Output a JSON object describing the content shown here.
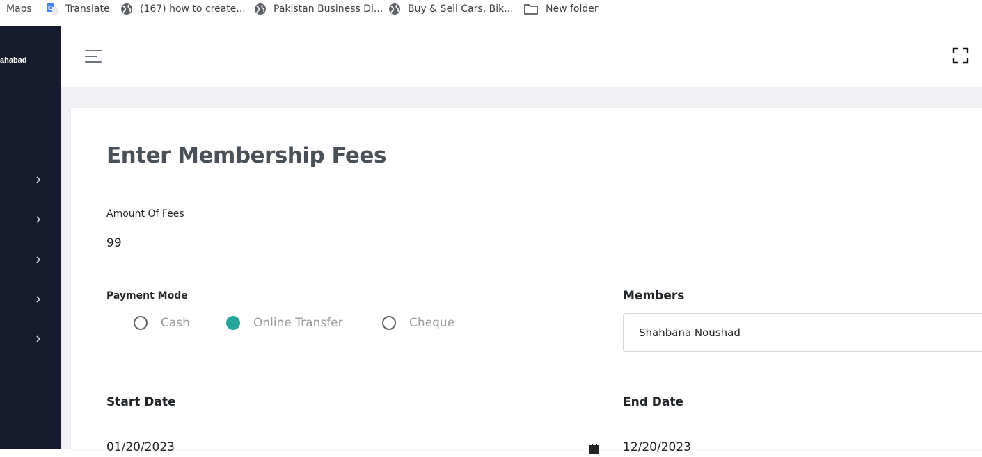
{
  "bookmarks": [
    {
      "label": "Maps",
      "icon": "maps-icon"
    },
    {
      "label": "Translate",
      "icon": "google-translate-icon"
    },
    {
      "label": "(167) how to create...",
      "icon": "globe-icon"
    },
    {
      "label": "Pakistan Business Di...",
      "icon": "globe-icon"
    },
    {
      "label": "Buy & Sell Cars, Bik...",
      "icon": "globe-icon"
    },
    {
      "label": "New folder",
      "icon": "folder-icon"
    }
  ],
  "sidebar": {
    "brand": "ahabad",
    "bg_color": "#161b2e"
  },
  "topbar": {
    "menu_icon": "hamburger-menu-icon",
    "fullscreen_icon": "fullscreen-icon"
  },
  "form": {
    "title": "Enter Membership Fees",
    "amount_label": "Amount Of Fees",
    "amount_value": "99",
    "payment_mode_label": "Payment Mode",
    "payment_options": [
      "Cash",
      "Online Transfer",
      "Cheque"
    ],
    "payment_selected": "Online Transfer",
    "members_label": "Members",
    "members_value": "Shahbana Noushad",
    "start_date_label": "Start Date",
    "start_date_value": "01/20/2023",
    "end_date_label": "End Date",
    "end_date_value": "12/20/2023",
    "accent_color": "#26a69a"
  }
}
